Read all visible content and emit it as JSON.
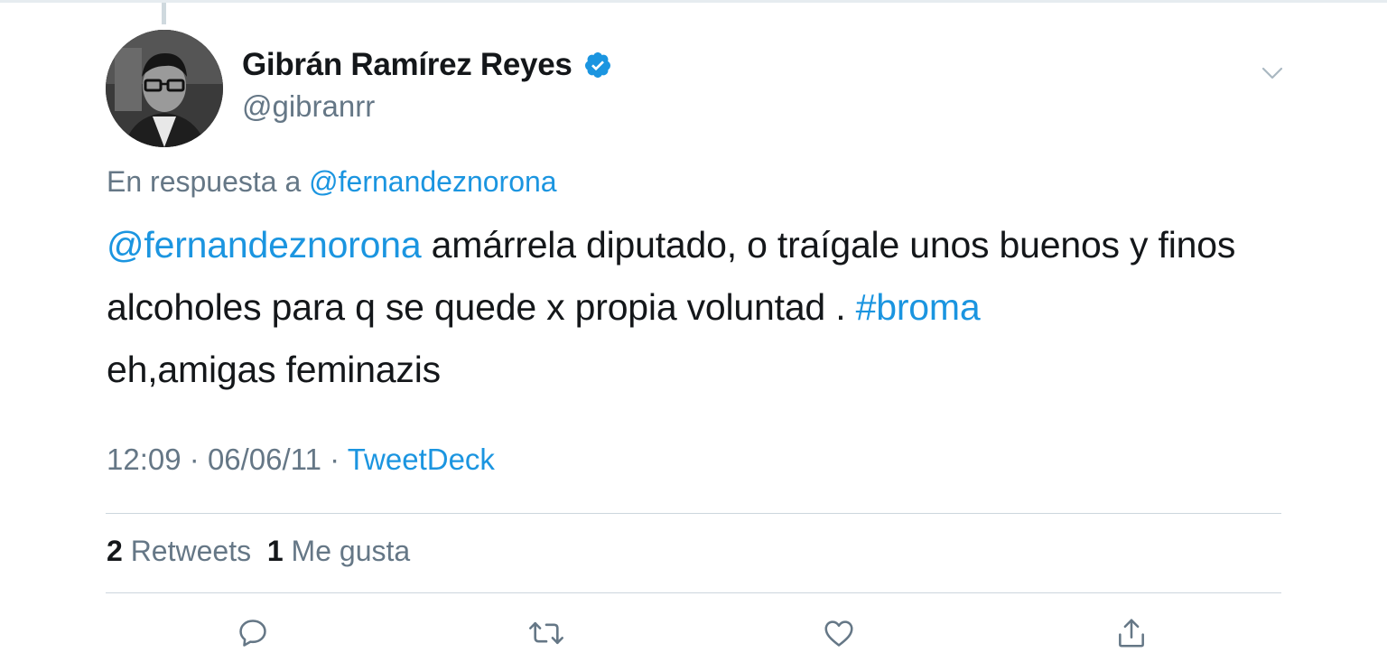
{
  "tweet": {
    "author_name": "Gibrán Ramírez Reyes",
    "handle": "@gibranrr",
    "verified": true,
    "reply_prefix": "En respuesta a",
    "reply_to": "@fernandeznorona",
    "text": {
      "mention": "@fernandeznorona",
      "part1": " amárrela diputado, o traígale unos buenos y finos alcoholes para q se quede x propia voluntad . ",
      "hashtag": "#broma",
      "part2": " eh,amigas feminazis"
    },
    "time": "12:09",
    "date": "06/06/11",
    "sep": "·",
    "source": "TweetDeck",
    "retweets_count": "2",
    "retweets_label": "Retweets",
    "likes_count": "1",
    "likes_label": "Me gusta"
  },
  "icons": {
    "verified": "verified-badge-icon",
    "menu": "chevron-down-icon",
    "reply": "reply-icon",
    "retweet": "retweet-icon",
    "like": "heart-icon",
    "share": "share-icon"
  },
  "colors": {
    "link": "#1b95e0",
    "secondary_text": "#657786",
    "primary_text": "#14171a",
    "divider": "#ccd6dd",
    "icon": "#657786"
  }
}
